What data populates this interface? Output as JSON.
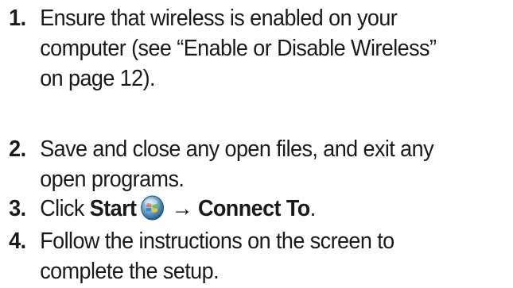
{
  "steps": [
    {
      "number": "1.",
      "lines": [
        "Ensure that wireless is enabled on your",
        "computer (see “Enable or Disable Wireless”",
        "on page 12)."
      ]
    },
    {
      "number": "2.",
      "lines": [
        "Save and close any open files, and exit any",
        "open programs."
      ]
    },
    {
      "number": "3.",
      "prefix": "Click ",
      "start_label": "Start",
      "start_icon": "windows-start-orb-icon",
      "arrow": " → ",
      "target_label": "Connect To",
      "suffix": "."
    },
    {
      "number": "4.",
      "lines": [
        "Follow the instructions on the screen  to",
        "complete the setup."
      ]
    }
  ]
}
